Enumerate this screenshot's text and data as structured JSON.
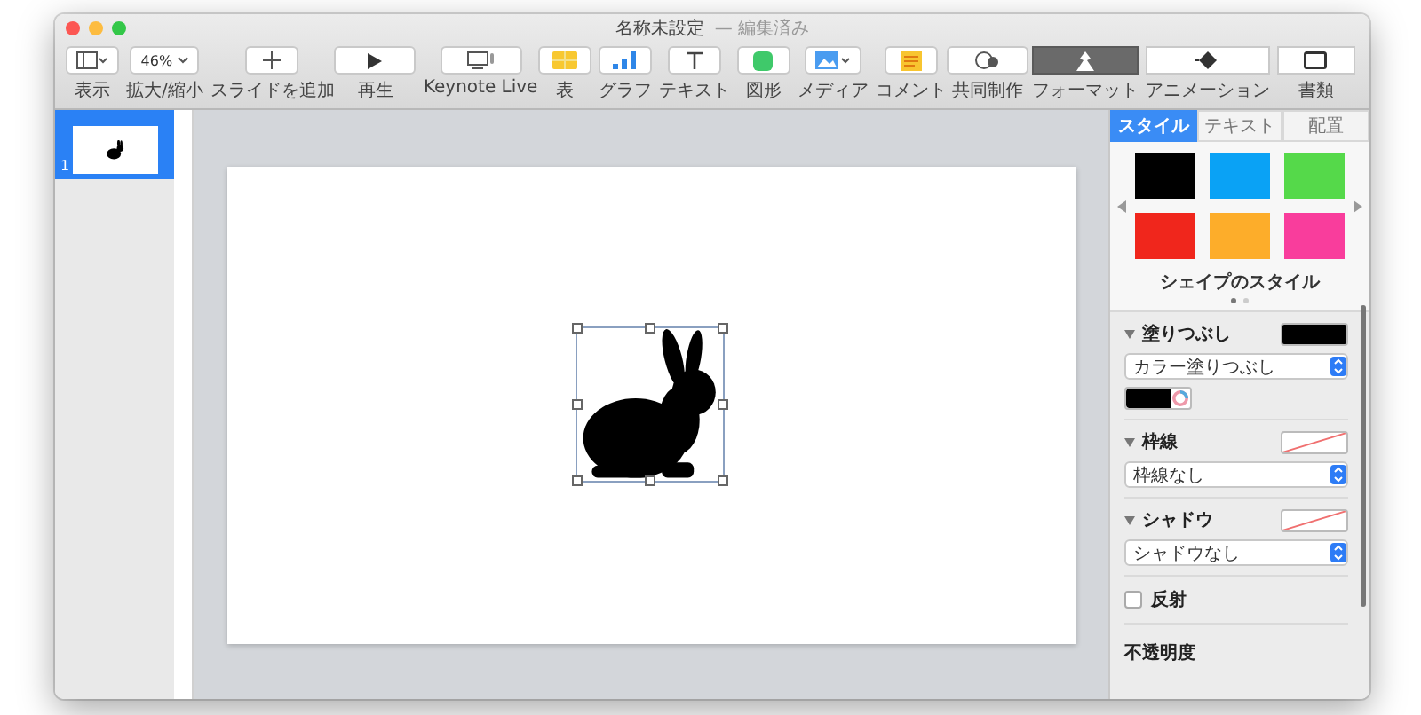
{
  "window": {
    "title": "名称未設定",
    "subtitle": "— 編集済み"
  },
  "toolbar": {
    "left": [
      {
        "kind": "view",
        "label": "表示"
      },
      {
        "kind": "zoom",
        "label": "拡大/縮小",
        "value": "46%"
      },
      {
        "kind": "add",
        "label": "スライドを追加"
      }
    ],
    "play": [
      {
        "kind": "play",
        "label": "再生"
      },
      {
        "kind": "live",
        "label": "Keynote Live"
      }
    ],
    "insert": [
      {
        "kind": "table",
        "label": "表"
      },
      {
        "kind": "chart",
        "label": "グラフ"
      },
      {
        "kind": "text",
        "label": "テキスト"
      },
      {
        "kind": "shape",
        "label": "図形"
      },
      {
        "kind": "media",
        "label": "メディア"
      },
      {
        "kind": "comment",
        "label": "コメント"
      }
    ],
    "collab": {
      "label": "共同制作"
    },
    "modes": [
      {
        "kind": "format",
        "label": "フォーマット",
        "selected": true
      },
      {
        "kind": "animate",
        "label": "アニメーション",
        "selected": false
      },
      {
        "kind": "document",
        "label": "書類",
        "selected": false
      }
    ]
  },
  "slides": [
    {
      "number": "1",
      "selected": true
    }
  ],
  "inspector": {
    "tabs": [
      {
        "label": "スタイル",
        "selected": true
      },
      {
        "label": "テキスト",
        "selected": false
      },
      {
        "label": "配置",
        "selected": false
      }
    ],
    "swatches": [
      {
        "color": "#000000"
      },
      {
        "color": "#0aa2f5"
      },
      {
        "color": "#55d94a"
      },
      {
        "color": "#f0261c"
      },
      {
        "color": "#fdad2a"
      },
      {
        "color": "#f93d9c"
      }
    ],
    "caption": "シェイプのスタイル",
    "pages": [
      {
        "selected": true
      },
      {
        "selected": false
      }
    ],
    "sections": [
      {
        "kind": "fill",
        "title": "塗りつぶし",
        "expanded": true,
        "popup": "カラー塗りつぶし",
        "color": "#000000"
      },
      {
        "kind": "border",
        "title": "枠線",
        "expanded": true,
        "popup": "枠線なし"
      },
      {
        "kind": "shadow",
        "title": "シャドウ",
        "expanded": true,
        "popup": "シャドウなし"
      }
    ],
    "reflection": {
      "label": "反射",
      "checked": false
    },
    "opacity": {
      "label": "不透明度"
    }
  }
}
